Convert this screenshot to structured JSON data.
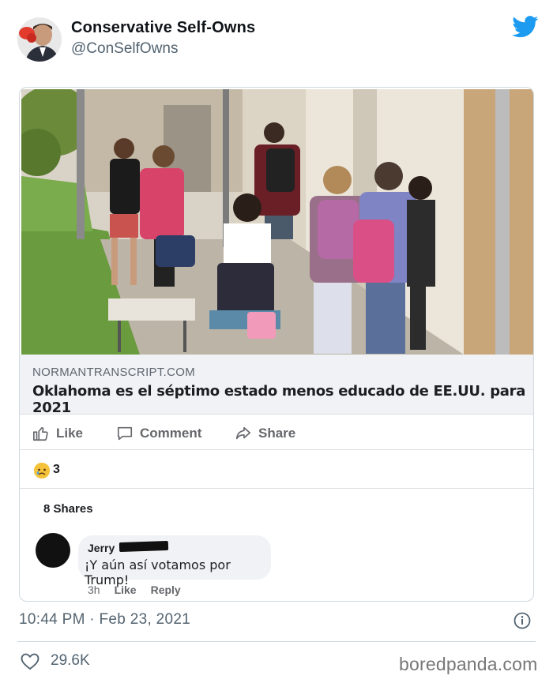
{
  "tweet": {
    "author_name": "Conservative Self-Owns",
    "author_handle": "@ConSelfOwns",
    "timestamp": "10:44 PM · Feb 23, 2021",
    "like_count": "29.6K",
    "brand_color": "#1d9bf0"
  },
  "fb_post": {
    "link_domain": "NORMANTRANSCRIPT.COM",
    "link_title": "Oklahoma es el séptimo estado menos educado de EE.UU. para 2021",
    "actions": [
      {
        "label": "Like",
        "icon": "thumbs-up-icon"
      },
      {
        "label": "Comment",
        "icon": "comment-icon"
      },
      {
        "label": "Share",
        "icon": "share-icon"
      }
    ],
    "reaction_count": "3",
    "reaction_icon": "sad-face-icon",
    "shares_text": "8 Shares",
    "comment": {
      "author": "Jerry",
      "text": "¡Y aún así votamos por Trump!",
      "time": "3h",
      "like_label": "Like",
      "reply_label": "Reply"
    }
  },
  "watermark": "boredpanda.com"
}
